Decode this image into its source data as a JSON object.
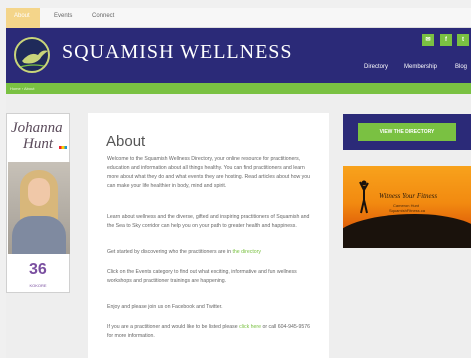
{
  "top_nav": {
    "tabs": [
      "About",
      "Events",
      "Connect"
    ]
  },
  "header": {
    "site_title": "SQUAMISH WELLNESS",
    "social": [
      "mail-icon",
      "facebook-icon",
      "twitter-icon"
    ],
    "social_glyphs": [
      "✉",
      "f",
      "t"
    ],
    "nav": [
      "Directory",
      "Membership",
      "Blog"
    ]
  },
  "subbar": {
    "text": "Home › About"
  },
  "ad_left": {
    "script_line1": "Johanna",
    "script_line2": "Hunt",
    "logo_mark": "36",
    "tagline": "KOKORE"
  },
  "main": {
    "heading": "About",
    "para1": "Welcome to the Squamish Wellness Directory, your online resource for practitioners, education and information about all things healthy. You can find practitioners and learn more about what they do and what events they are hosting. Read articles about how you can make your life healthier in body, mind and spirit.",
    "para2": "Learn about wellness and the diverse, gifted and inspiring practitioners of Squamish and the Sea to Sky corridor can help you on your path to greater health and happiness.",
    "para3_text": "Get started by discovering who the practitioners are in ",
    "para3_link": "the directory",
    "para4": "Click on the Events category to find out what exciting, informative and fun wellness workshops and practitioner trainings are happening.",
    "para5": "Enjoy and please join us on Facebook and Twitter.",
    "para6_text": "If you are a practitioner and would like to be listed please ",
    "para6_link": "click here",
    "para6_tail": "or call 604-945-9576 for more information."
  },
  "sidebar": {
    "directory_button": "VIEW THE DIRECTORY",
    "ad_title": "Witness Your Fitness",
    "ad_name": "Cameron Hunt",
    "ad_site": "SquamishFitness.ca"
  },
  "colors": {
    "navy": "#2b2a78",
    "green": "#7ac142"
  }
}
